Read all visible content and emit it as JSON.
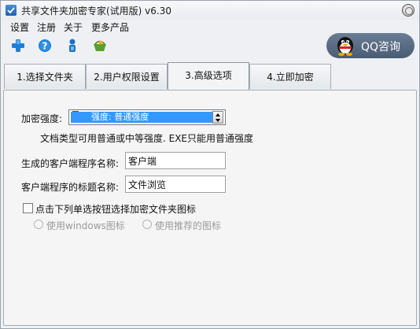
{
  "window": {
    "title": "共享文件夹加密专家(试用版) v6.30"
  },
  "menu": {
    "items": [
      "设置",
      "注册",
      "关于",
      "更多产品"
    ]
  },
  "toolbar": {
    "icons": [
      "add-icon",
      "help-icon",
      "user-icon",
      "basket-icon"
    ],
    "qq_label": "QQ咨询",
    "colors": {
      "add": "#1e7fd6",
      "help": "#1e7fd6",
      "user": "#1e6fc4",
      "basket": "#5aa02c"
    }
  },
  "tabs": {
    "items": [
      {
        "label": "1.选择文件夹",
        "active": false
      },
      {
        "label": "2.用户权限设置",
        "active": false
      },
      {
        "label": "3.高级选项",
        "active": true
      },
      {
        "label": "4.立即加密",
        "active": false
      }
    ]
  },
  "advanced": {
    "strength_label": "加密强度:",
    "strength_value": "强度: 普通强度",
    "strength_note": "文档类型可用普通或中等强度. EXE只能用普通强度",
    "client_name_label": "生成的客户端程序名称:",
    "client_name_value": "客户端",
    "client_title_label": "客户端程序的标题名称:",
    "client_title_value": "文件浏览",
    "icon_checkbox_label": "点击下列单选按钮选择加密文件夹图标",
    "icon_checkbox_checked": false,
    "radio_windows_label": "使用windows图标",
    "radio_recommended_label": "使用推荐的图标",
    "selection_color": "#3399ff"
  }
}
